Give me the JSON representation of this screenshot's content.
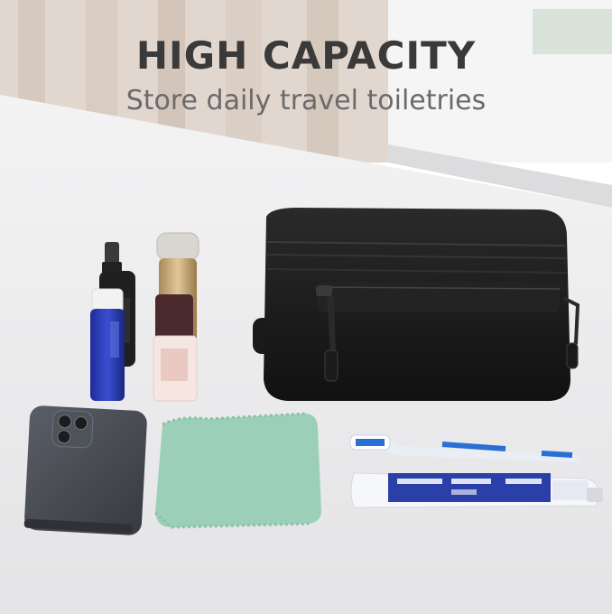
{
  "headline": {
    "title": "HIGH CAPACITY",
    "subtitle": "Store daily travel toiletries"
  },
  "colors": {
    "title": "#3a3a3a",
    "subtitle": "#6a6a6a",
    "bag": "#1c1c1c",
    "towel": "#9ccfb8",
    "phone": "#4a4d55",
    "toothpaste_band": "#2b3fa8",
    "toothbrush_accent": "#2a6fd6"
  },
  "objects": {
    "bag": "black-toiletry-bag",
    "phone": "smartphone",
    "towel": "green-towel",
    "toothbrush": "toothbrush",
    "toothpaste": "toothpaste-tube",
    "spray_bottle": "spray-bottle",
    "blue_bottle": "blue-bottle",
    "pump_bottle": "pump-bottle",
    "small_bottle": "small-pink-bottle"
  }
}
